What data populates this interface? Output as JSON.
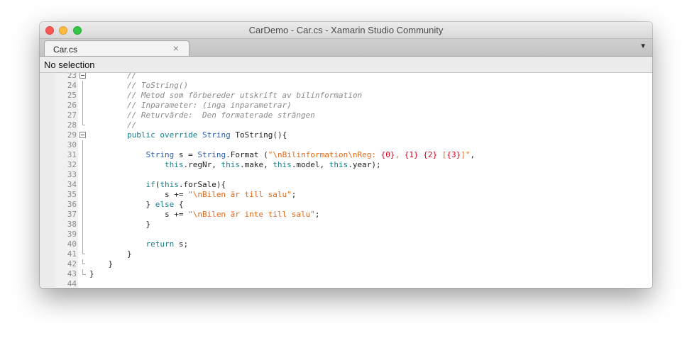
{
  "window": {
    "title": "CarDemo - Car.cs - Xamarin Studio Community"
  },
  "tabs": [
    {
      "label": "Car.cs",
      "close_glyph": "×"
    }
  ],
  "tab_dropdown_glyph": "▼",
  "pathbar": {
    "label": "No selection"
  },
  "editor": {
    "lines": [
      {
        "n": "23",
        "fold": "box",
        "tokens": [
          {
            "t": "        ",
            "c": "tx"
          },
          {
            "t": "//",
            "c": "cm"
          }
        ]
      },
      {
        "n": "24",
        "fold": "vline",
        "tokens": [
          {
            "t": "        ",
            "c": "tx"
          },
          {
            "t": "// ToString()",
            "c": "cm"
          }
        ]
      },
      {
        "n": "25",
        "fold": "vline",
        "tokens": [
          {
            "t": "        ",
            "c": "tx"
          },
          {
            "t": "// Metod som förbereder utskrift av bilinformation",
            "c": "cm"
          }
        ]
      },
      {
        "n": "26",
        "fold": "vline",
        "tokens": [
          {
            "t": "        ",
            "c": "tx"
          },
          {
            "t": "// Inparameter: (inga inparametrar)",
            "c": "cm"
          }
        ]
      },
      {
        "n": "27",
        "fold": "vline",
        "tokens": [
          {
            "t": "        ",
            "c": "tx"
          },
          {
            "t": "// Returvärde:  Den formaterade strängen",
            "c": "cm"
          }
        ]
      },
      {
        "n": "28",
        "fold": "tick",
        "tokens": [
          {
            "t": "        ",
            "c": "tx"
          },
          {
            "t": "//",
            "c": "cm"
          }
        ]
      },
      {
        "n": "29",
        "fold": "box",
        "tokens": [
          {
            "t": "        ",
            "c": "tx"
          },
          {
            "t": "public",
            "c": "kw"
          },
          {
            "t": " ",
            "c": "tx"
          },
          {
            "t": "override",
            "c": "kw"
          },
          {
            "t": " ",
            "c": "tx"
          },
          {
            "t": "String",
            "c": "ty"
          },
          {
            "t": " ToString(){",
            "c": "tx"
          }
        ]
      },
      {
        "n": "30",
        "fold": "vline",
        "tokens": []
      },
      {
        "n": "31",
        "fold": "vline",
        "tokens": [
          {
            "t": "            ",
            "c": "tx"
          },
          {
            "t": "String",
            "c": "ty"
          },
          {
            "t": " s = ",
            "c": "tx"
          },
          {
            "t": "String",
            "c": "ty"
          },
          {
            "t": ".Format (",
            "c": "tx"
          },
          {
            "t": "\"\\nBilinformation\\nReg: ",
            "c": "st"
          },
          {
            "t": "{0}",
            "c": "fm"
          },
          {
            "t": ", ",
            "c": "st"
          },
          {
            "t": "{1}",
            "c": "fm"
          },
          {
            "t": " ",
            "c": "st"
          },
          {
            "t": "{2}",
            "c": "fm"
          },
          {
            "t": " [",
            "c": "st"
          },
          {
            "t": "{3}",
            "c": "fm"
          },
          {
            "t": "]\"",
            "c": "st"
          },
          {
            "t": ",",
            "c": "tx"
          }
        ]
      },
      {
        "n": "32",
        "fold": "vline",
        "tokens": [
          {
            "t": "                ",
            "c": "tx"
          },
          {
            "t": "this",
            "c": "kw"
          },
          {
            "t": ".regNr, ",
            "c": "tx"
          },
          {
            "t": "this",
            "c": "kw"
          },
          {
            "t": ".make, ",
            "c": "tx"
          },
          {
            "t": "this",
            "c": "kw"
          },
          {
            "t": ".model, ",
            "c": "tx"
          },
          {
            "t": "this",
            "c": "kw"
          },
          {
            "t": ".year);",
            "c": "tx"
          }
        ]
      },
      {
        "n": "33",
        "fold": "vline",
        "tokens": []
      },
      {
        "n": "34",
        "fold": "vline",
        "tokens": [
          {
            "t": "            ",
            "c": "tx"
          },
          {
            "t": "if",
            "c": "kw"
          },
          {
            "t": "(",
            "c": "tx"
          },
          {
            "t": "this",
            "c": "kw"
          },
          {
            "t": ".forSale){",
            "c": "tx"
          }
        ]
      },
      {
        "n": "35",
        "fold": "vline",
        "tokens": [
          {
            "t": "                s += ",
            "c": "tx"
          },
          {
            "t": "\"\\nBilen är till salu\"",
            "c": "st"
          },
          {
            "t": ";",
            "c": "tx"
          }
        ]
      },
      {
        "n": "36",
        "fold": "vline",
        "tokens": [
          {
            "t": "            } ",
            "c": "tx"
          },
          {
            "t": "else",
            "c": "kw"
          },
          {
            "t": " {",
            "c": "tx"
          }
        ]
      },
      {
        "n": "37",
        "fold": "vline",
        "tokens": [
          {
            "t": "                s += ",
            "c": "tx"
          },
          {
            "t": "\"\\nBilen är inte till salu\"",
            "c": "st"
          },
          {
            "t": ";",
            "c": "tx"
          }
        ]
      },
      {
        "n": "38",
        "fold": "vline",
        "tokens": [
          {
            "t": "            }",
            "c": "tx"
          }
        ]
      },
      {
        "n": "39",
        "fold": "vline",
        "tokens": []
      },
      {
        "n": "40",
        "fold": "vline",
        "tokens": [
          {
            "t": "            ",
            "c": "tx"
          },
          {
            "t": "return",
            "c": "kw"
          },
          {
            "t": " s;",
            "c": "tx"
          }
        ]
      },
      {
        "n": "41",
        "fold": "tick",
        "tokens": [
          {
            "t": "        }",
            "c": "tx"
          }
        ]
      },
      {
        "n": "42",
        "fold": "tick",
        "tokens": [
          {
            "t": "    }",
            "c": "tx"
          }
        ]
      },
      {
        "n": "43",
        "fold": "end",
        "tokens": [
          {
            "t": "}",
            "c": "tx"
          }
        ]
      },
      {
        "n": "44",
        "fold": "none",
        "tokens": []
      }
    ]
  },
  "colors": {
    "keyword": "#177e8a",
    "type": "#2a5dab",
    "string": "#e06a1b",
    "format_placeholder": "#d0021b",
    "comment": "#8a8a8a"
  }
}
